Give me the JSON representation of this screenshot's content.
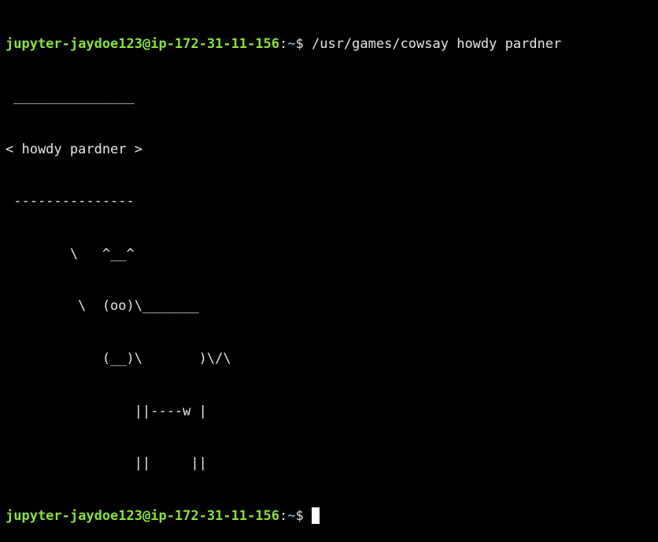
{
  "terminal": {
    "prompt": {
      "user_host": "jupyter-jaydoe123@ip-172-31-11-156",
      "separator": ":",
      "path": "~",
      "symbol": "$ "
    },
    "command": "/usr/games/cowsay howdy pardner",
    "output_lines": [
      " _______________",
      "< howdy pardner >",
      " ---------------",
      "        \\   ^__^",
      "         \\  (oo)\\_______",
      "            (__)\\       )\\/\\",
      "                ||----w |",
      "                ||     ||"
    ]
  },
  "colors": {
    "background": "#000000",
    "text": "#e5e5e5",
    "prompt_user": "#8ae234",
    "prompt_path": "#729fcf",
    "cursor": "#ffffff"
  }
}
